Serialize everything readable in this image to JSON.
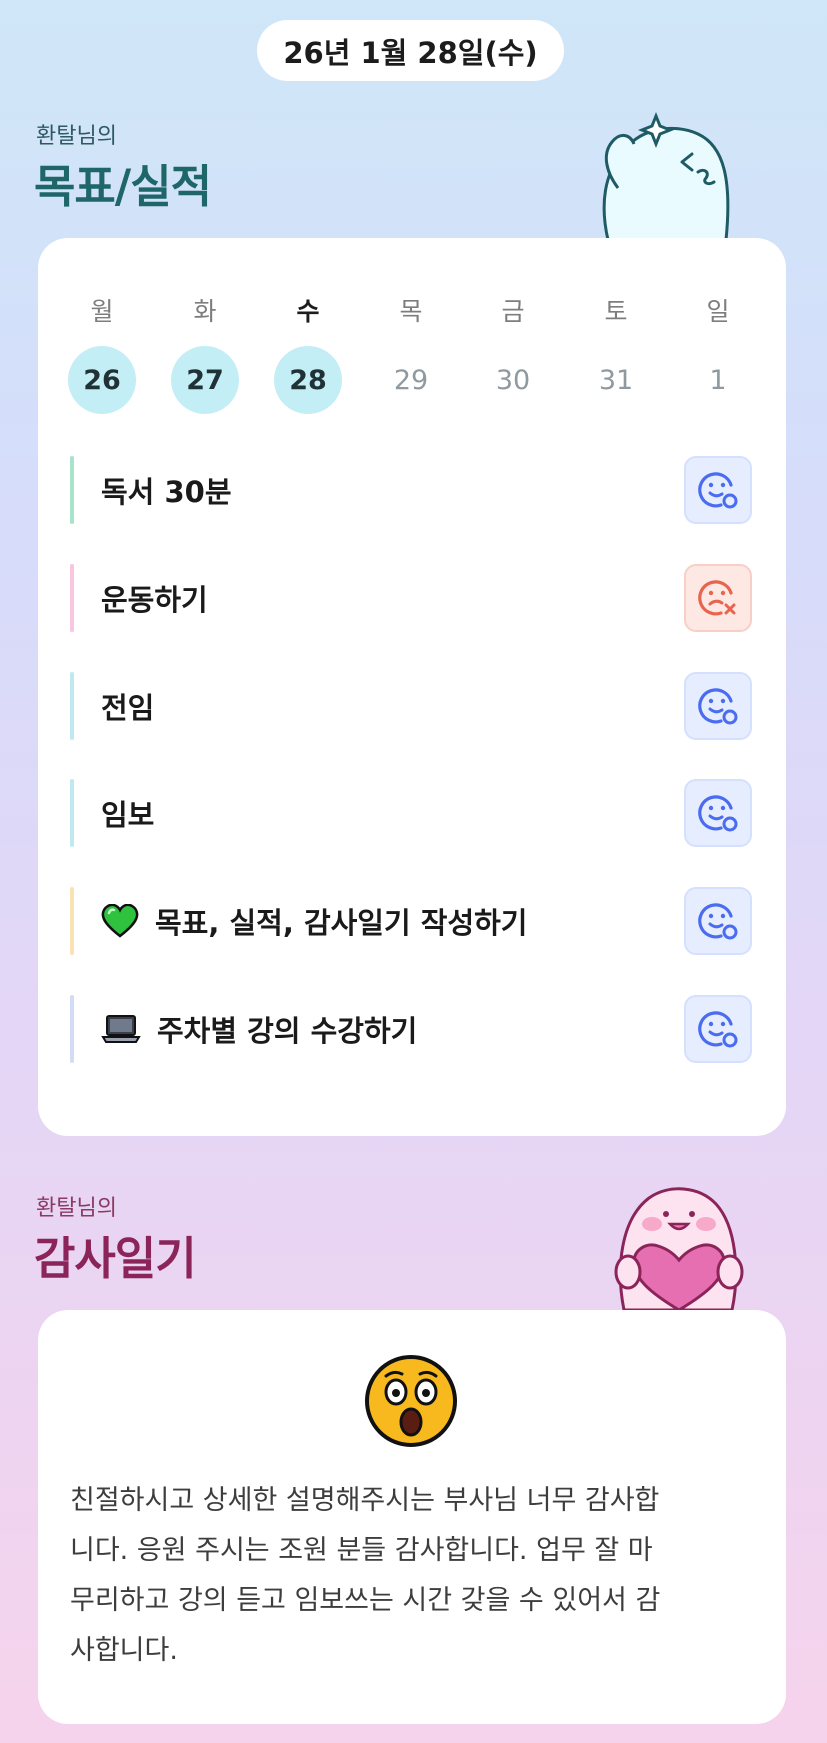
{
  "header": {
    "date": "26년 1월 28일(수)"
  },
  "goals_section": {
    "subtitle": "환탈님의",
    "title": "목표/실적"
  },
  "week": {
    "days": [
      {
        "day": "월",
        "date": "26",
        "status": "done"
      },
      {
        "day": "화",
        "date": "27",
        "status": "done"
      },
      {
        "day": "수",
        "date": "28",
        "status": "done",
        "today": true
      },
      {
        "day": "목",
        "date": "29",
        "status": "none"
      },
      {
        "day": "금",
        "date": "30",
        "status": "none"
      },
      {
        "day": "토",
        "date": "31",
        "status": "none"
      },
      {
        "day": "일",
        "date": "1",
        "status": "none"
      }
    ]
  },
  "goals": [
    {
      "label": "독서 30분",
      "emoji": "",
      "bar_color": "#a6e4cc",
      "result": "achieved"
    },
    {
      "label": "운동하기",
      "emoji": "",
      "bar_color": "#f8c6df",
      "result": "failed"
    },
    {
      "label": "전임",
      "emoji": "",
      "bar_color": "#bfe9f1",
      "result": "achieved"
    },
    {
      "label": "임보",
      "emoji": "",
      "bar_color": "#bfe9f1",
      "result": "achieved"
    },
    {
      "label": "목표, 실적, 감사일기 작성하기",
      "emoji": "green-heart-icon",
      "bar_color": "#fbe2b2",
      "result": "achieved"
    },
    {
      "label": "주차별 강의 수강하기",
      "emoji": "laptop-icon",
      "bar_color": "#d3dcf6",
      "result": "achieved"
    }
  ],
  "colors": {
    "achieved_icon": "#4a6cf0",
    "failed_icon": "#e8644e",
    "done_circle": "#c4eef6"
  },
  "diary_section": {
    "subtitle": "환탈님의",
    "title": "감사일기"
  },
  "diary": {
    "mood_icon": "astonished-face-icon",
    "lines": [
      "친절하시고 상세한 설명해주시는 부사님 너무 감사합",
      "니다. 응원 주시는 조원 분들 감사합니다. 업무 잘 마",
      "무리하고 강의 듣고 임보쓰는 시간 갖을 수 있어서 감",
      "사합니다."
    ]
  }
}
